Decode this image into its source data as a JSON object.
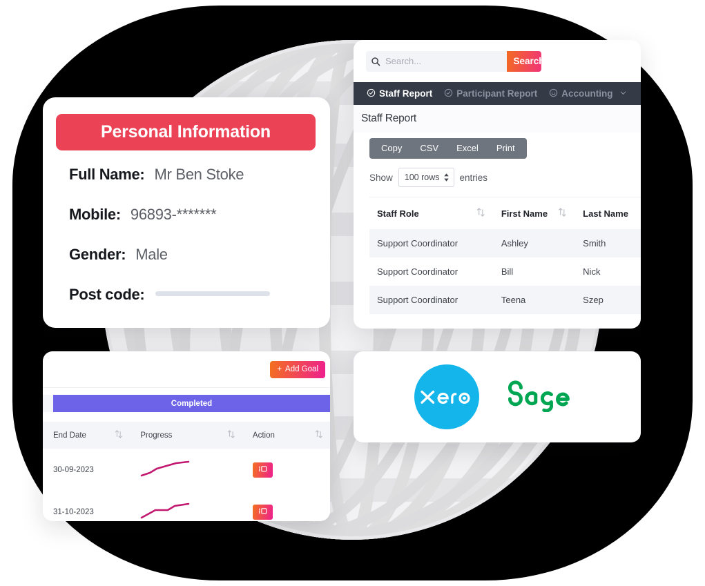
{
  "personal_information": {
    "header_title": "Personal Information",
    "header_color": "#ec4256",
    "fields": [
      {
        "label": "Full Name:",
        "value": "Mr Ben Stoke",
        "redacted": false
      },
      {
        "label": "Mobile:",
        "value": "96893-*******",
        "redacted": false
      },
      {
        "label": "Gender:",
        "value": "Male",
        "redacted": false
      },
      {
        "label": "Post code:",
        "value": "",
        "redacted": true
      }
    ]
  },
  "staff_report": {
    "search": {
      "placeholder": "Search...",
      "value": "",
      "button_label": "Search",
      "icon": "search-icon",
      "gradient_from": "#f36b21",
      "gradient_to": "#f0268f"
    },
    "nav": {
      "background": "#343a46",
      "items": [
        {
          "label": "Staff Report",
          "icon": "check-circle-icon",
          "active": true,
          "has_chevron": false
        },
        {
          "label": "Participant Report",
          "icon": "check-circle-icon",
          "active": false,
          "has_chevron": false
        },
        {
          "label": "Accounting",
          "icon": "smiley-circle-icon",
          "active": false,
          "has_chevron": true
        }
      ]
    },
    "page_title": "Staff Report",
    "export_buttons": [
      "Copy",
      "CSV",
      "Excel",
      "Print"
    ],
    "show_entries": {
      "prefix": "Show",
      "selected": "100 rows",
      "suffix": "entries"
    },
    "table": {
      "columns": [
        "Staff Role",
        "First Name",
        "Last Name"
      ],
      "rows": [
        [
          "Support Coordinator",
          "Ashley",
          "Smith"
        ],
        [
          "Support Coordinator",
          "Bill",
          "Nick"
        ],
        [
          "Support Coordinator",
          "Teena",
          "Szep"
        ]
      ]
    }
  },
  "goals": {
    "add_button_label": "Add Goal",
    "add_button_plus": "+",
    "status_label": "Completed",
    "status_color": "#6c63e8",
    "table": {
      "columns": [
        "End Date",
        "Progress",
        "Action"
      ],
      "rows": [
        {
          "end_date": "30-09-2023",
          "progress": "sparkline-rising",
          "action": "view-icon"
        },
        {
          "end_date": "31-10-2023",
          "progress": "sparkline-rising",
          "action": "view-icon"
        }
      ]
    },
    "sparkline_color": "#c2186f"
  },
  "integrations": {
    "logos": [
      {
        "name": "xero",
        "wordmark": "xero",
        "color": "#13b5ea"
      },
      {
        "name": "sage",
        "wordmark": "Sage",
        "color": "#00a651"
      }
    ]
  }
}
